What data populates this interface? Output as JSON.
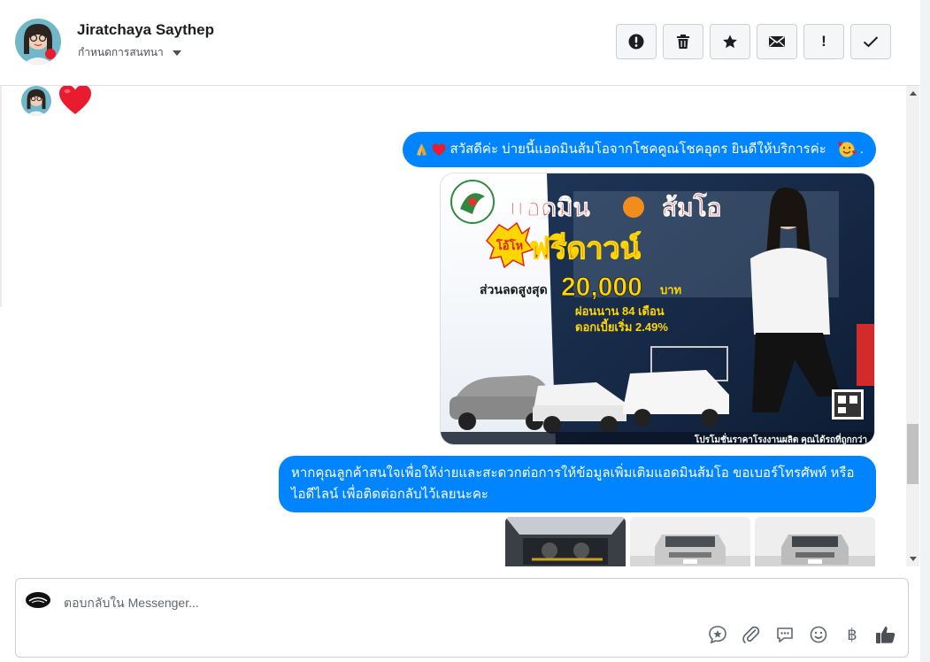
{
  "header": {
    "contact_name": "Jiratchaya Saythep",
    "assign_label": "กำหนดการสนทนา"
  },
  "toolbar": {
    "icons": [
      "alert-circle-icon",
      "trash-icon",
      "star-icon",
      "envelope-icon",
      "exclamation-icon",
      "checkmark-icon"
    ],
    "mark_important_text": "!"
  },
  "thread": {
    "messages": [
      {
        "from": "customer",
        "type": "emoji",
        "icon": "heart-icon"
      },
      {
        "from": "page",
        "type": "text",
        "text": "สวัสดีค่ะ บ่ายนี้แอดมินส้มโอจากโชคคูณโชคอุดร ยินดีให้บริการค่ะ",
        "prefix_icons": [
          "praying-hands-icon",
          "heart-icon"
        ],
        "suffix_icons": [
          "smiling-face-hearts-icon"
        ],
        "suffix_text": "."
      },
      {
        "from": "page",
        "type": "image",
        "content": {
          "headline": "แอดมิน",
          "headline_name": "ส้มโอ",
          "badge": "โอ้โห",
          "offer": "ฟรีดาวน์",
          "discount_label": "ส่วนลดสูงสุด",
          "discount_amount": "20,000",
          "discount_unit": "บาท",
          "installment": "ผ่อนนาน 84 เดือน",
          "interest": "ดอกเบี้ยเริ่ม 2.49%",
          "footer": "โปรโมชั่นราคาโรงงานผลิต คุณได้รถที่ถูกกว่า"
        }
      },
      {
        "from": "page",
        "type": "text",
        "text": "หากคุณลูกค้าสนใจเพื่อให้ง่ายและสะดวกต่อการให้ข้อมูลเพิ่มเติมแอดมินส้มโอ ขอเบอร์โทรศัพท์ หรือ ไอดีไลน์ เพื่อติดต่อกลับไว้เลยนะคะ"
      },
      {
        "from": "page",
        "type": "image-group",
        "count": 3
      }
    ]
  },
  "composer": {
    "placeholder": "ตอบกลับใน Messenger...",
    "icons": [
      "saved-reply-icon",
      "paperclip-icon",
      "chat-bubble-icon",
      "smiley-icon",
      "baht-icon",
      "thumbs-up-icon"
    ],
    "baht_symbol": "฿"
  },
  "colors": {
    "bubble": "#0084ff",
    "toolbar_bg": "#f5f6f7",
    "heart": "#e81c2e"
  }
}
